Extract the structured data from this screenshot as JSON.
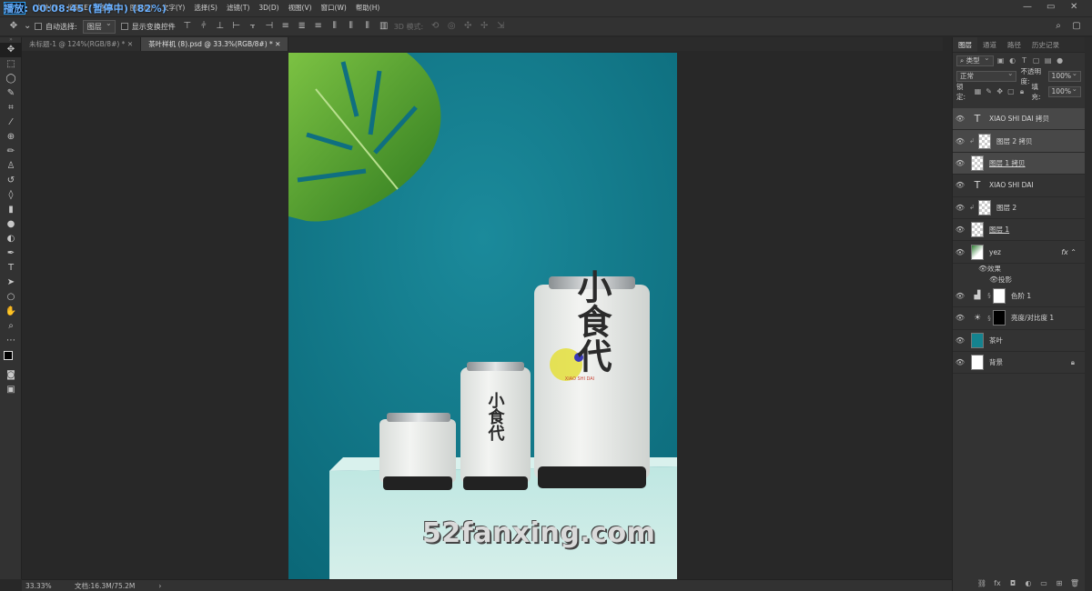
{
  "titlebar": {
    "timer": "播放: 00:08:45 (暂停中) (82%)"
  },
  "menu": [
    "文件(F)",
    "编辑(E)",
    "图像(I)",
    "图层(L)",
    "文字(Y)",
    "选择(S)",
    "滤镜(T)",
    "3D(D)",
    "视图(V)",
    "窗口(W)",
    "帮助(H)"
  ],
  "options": {
    "auto_select_label": "自动选择:",
    "auto_select_value": "图层",
    "transform_label": "显示变换控件",
    "mode_3d_label": "3D 模式:"
  },
  "tabs": [
    {
      "label": "未标题-1 @ 124%(RGB/8#) *",
      "active": false
    },
    {
      "label": "茶叶样机 (8).psd @ 33.3%(RGB/8#) *",
      "active": true
    }
  ],
  "watermark": "52fanxing.com",
  "status": {
    "zoom": "33.33%",
    "doc": "文档:16.3M/75.2M"
  },
  "panel": {
    "tabs": [
      "图层",
      "通道",
      "路径",
      "历史记录"
    ],
    "filter_type": "类型",
    "blend_mode": "正常",
    "opacity_label": "不透明度:",
    "opacity_value": "100%",
    "lock_label": "锁定:",
    "fill_label": "填充:",
    "fill_value": "100%"
  },
  "layers": [
    {
      "name": "XIAO SHI DAI 拷贝",
      "kind": "text",
      "clipped": false,
      "selected": true
    },
    {
      "name": "图层 2 拷贝",
      "kind": "pixel",
      "clipped": true,
      "selected": true
    },
    {
      "name": "图层 1 拷贝",
      "kind": "pixel",
      "clipped": false,
      "selected": true
    },
    {
      "name": "XIAO SHI DAI",
      "kind": "text",
      "clipped": false,
      "selected": false
    },
    {
      "name": "图层 2",
      "kind": "pixel",
      "clipped": true,
      "selected": false
    },
    {
      "name": "图层 1",
      "kind": "pixel",
      "clipped": false,
      "selected": false
    },
    {
      "name": "yez",
      "kind": "photo",
      "clipped": false,
      "selected": false
    },
    {
      "name": "色阶 1",
      "kind": "adjust",
      "clipped": false,
      "selected": false
    },
    {
      "name": "亮度/对比度 1",
      "kind": "adjust",
      "clipped": false,
      "selected": false
    },
    {
      "name": "茶叶",
      "kind": "smart",
      "clipped": false,
      "selected": false
    },
    {
      "name": "背景",
      "kind": "background",
      "clipped": false,
      "selected": false
    }
  ],
  "effects": {
    "label": "效果",
    "drop_shadow": "投影"
  },
  "artwork": {
    "can_big_text": "小食代",
    "can_mid_text": "小食代",
    "can_sub_text": "XIAO SHI DAI"
  },
  "colors": {
    "teal": "#11788a",
    "panel": "#333333"
  }
}
